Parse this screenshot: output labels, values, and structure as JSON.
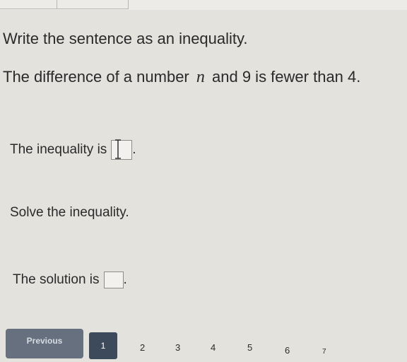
{
  "question": {
    "instruction": "Write the sentence as an inequality.",
    "sentence_before": "The difference of a number",
    "variable": "n",
    "sentence_after": "and 9 is fewer than 4."
  },
  "inequality": {
    "label": "The inequality is",
    "trailing": ".",
    "value": ""
  },
  "solve": {
    "prompt": "Solve the inequality."
  },
  "solution": {
    "label": "The solution is",
    "trailing": ".",
    "value": ""
  },
  "pagination": {
    "previous_label": "Previous",
    "pages": [
      "1",
      "2",
      "3",
      "4",
      "5",
      "6",
      "7"
    ],
    "current": "1"
  },
  "colors": {
    "background": "#e4e2dd",
    "previous_button": "#66707f",
    "active_page": "#3d4a5b"
  }
}
